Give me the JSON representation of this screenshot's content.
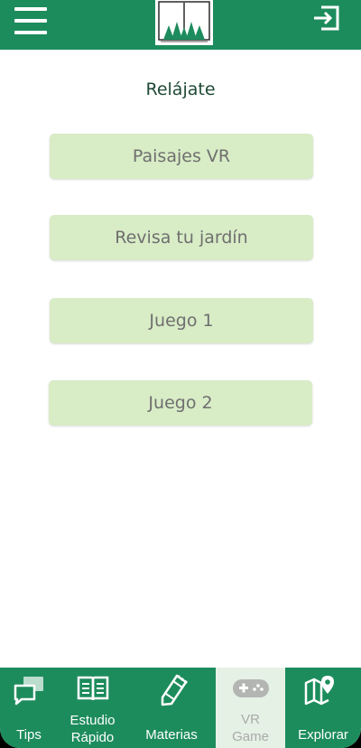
{
  "header": {
    "menu_icon": "hamburger-menu-icon",
    "logo": "forest-book-logo",
    "logout_icon": "logout-icon"
  },
  "main": {
    "title": "Relájate",
    "options": [
      {
        "label": "Paisajes VR"
      },
      {
        "label": "Revisa tu jardín"
      },
      {
        "label": "Juego 1"
      },
      {
        "label": "Juego 2"
      }
    ]
  },
  "bottom_nav": {
    "items": [
      {
        "label": "Tips",
        "icon": "chat-bubbles-icon"
      },
      {
        "label_line1": "Estudio",
        "label_line2": "Rápido",
        "icon": "open-book-icon"
      },
      {
        "label": "Materias",
        "icon": "notebook-pencil-icon"
      },
      {
        "label_line1": "VR",
        "label_line2": "Game",
        "icon": "gamepad-icon",
        "active": true
      },
      {
        "label": "Explorar",
        "icon": "map-pin-icon"
      }
    ]
  },
  "colors": {
    "primary": "#1d8c5c",
    "button_bg": "#d8ecc6",
    "button_text": "#6f6f6f",
    "title_text": "#1f4a35",
    "active_tab_bg": "#e6f1e6"
  }
}
